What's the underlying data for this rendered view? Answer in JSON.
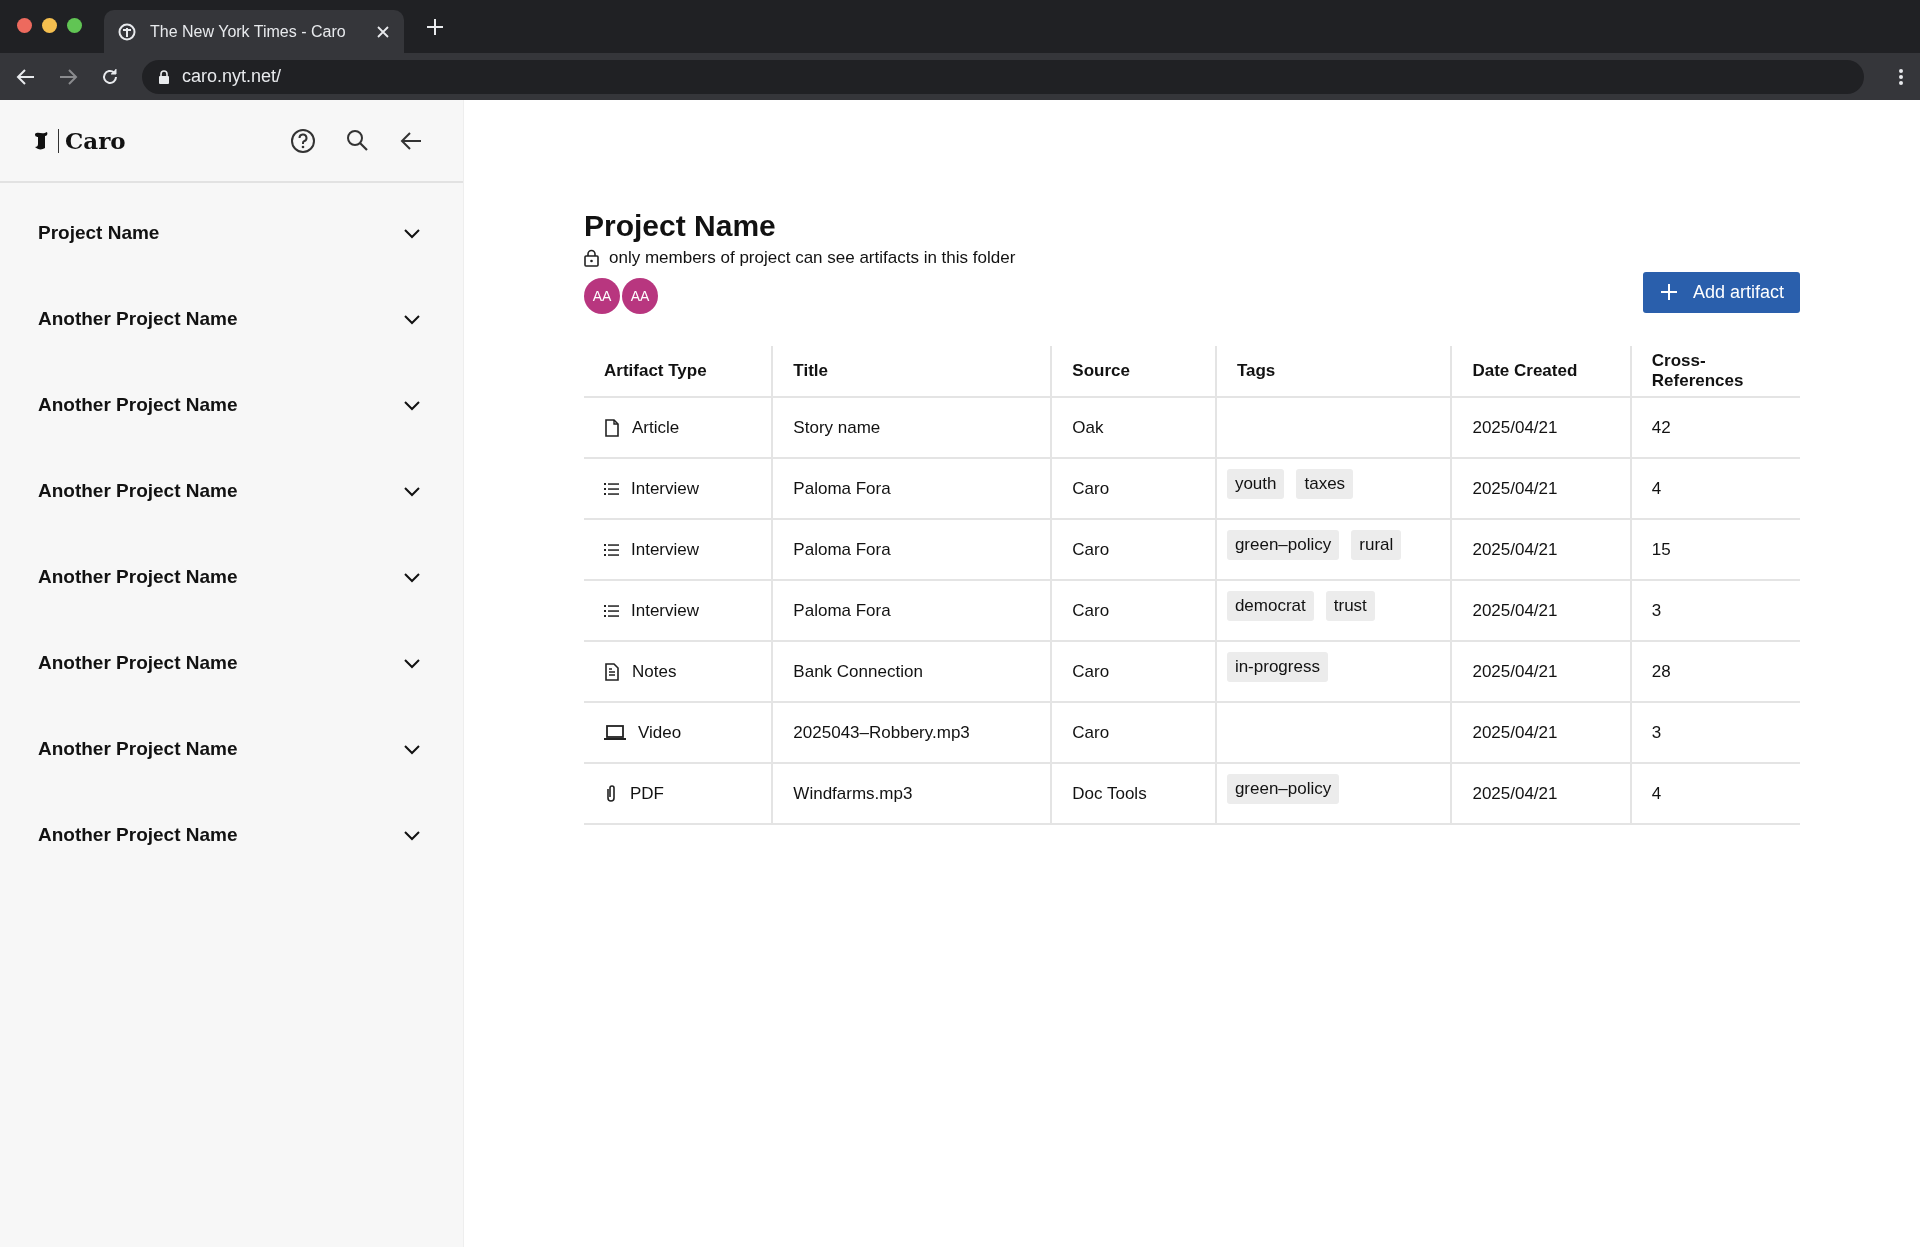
{
  "browser": {
    "tab_title": "The New York Times - Caro",
    "url": "caro.nyt.net/"
  },
  "sidebar": {
    "app_name": "Caro",
    "projects": [
      {
        "name": "Project Name",
        "expanded": false
      },
      {
        "name": "Another Project Name",
        "expanded": false
      },
      {
        "name": "Another Project Name",
        "expanded": false
      },
      {
        "name": "Another Project Name",
        "expanded": false
      },
      {
        "name": "Another Project Name",
        "expanded": false
      },
      {
        "name": "Another Project Name",
        "expanded": false
      },
      {
        "name": "Another Project Name",
        "expanded": false
      },
      {
        "name": "Another Project Name",
        "expanded": false
      }
    ]
  },
  "project": {
    "title": "Project Name",
    "privacy_note": "only members of project can see artifacts in this folder",
    "members": [
      {
        "initials": "AA",
        "color": "#b8367f"
      },
      {
        "initials": "AA",
        "color": "#b8367f"
      }
    ],
    "add_button": "Add artifact"
  },
  "table": {
    "columns": [
      "Artifact Type",
      "Title",
      "Source",
      "Tags",
      "Date Created",
      "Cross-References"
    ],
    "rows": [
      {
        "kind": "article",
        "type": "Article",
        "title": "Story name",
        "source": "Oak",
        "tags": [],
        "date": "2025/04/21",
        "cross_references": "42"
      },
      {
        "kind": "interview",
        "type": "Interview",
        "title": "Paloma Fora",
        "source": "Caro",
        "tags": [
          "youth",
          "taxes"
        ],
        "date": "2025/04/21",
        "cross_references": "4"
      },
      {
        "kind": "interview",
        "type": "Interview",
        "title": "Paloma Fora",
        "source": "Caro",
        "tags": [
          "green–policy",
          "rural"
        ],
        "date": "2025/04/21",
        "cross_references": "15"
      },
      {
        "kind": "interview",
        "type": "Interview",
        "title": "Paloma Fora",
        "source": "Caro",
        "tags": [
          "democrat",
          "trust"
        ],
        "date": "2025/04/21",
        "cross_references": "3"
      },
      {
        "kind": "notes",
        "type": "Notes",
        "title": "Bank Connection",
        "source": "Caro",
        "tags": [
          "in-progress"
        ],
        "date": "2025/04/21",
        "cross_references": "28"
      },
      {
        "kind": "video",
        "type": "Video",
        "title": "2025043–Robbery.mp3",
        "source": "Caro",
        "tags": [],
        "date": "2025/04/21",
        "cross_references": "3"
      },
      {
        "kind": "pdf",
        "type": "PDF",
        "title": "Windfarms.mp3",
        "source": "Doc Tools",
        "tags": [
          "green–policy"
        ],
        "date": "2025/04/21",
        "cross_references": "4"
      }
    ]
  }
}
